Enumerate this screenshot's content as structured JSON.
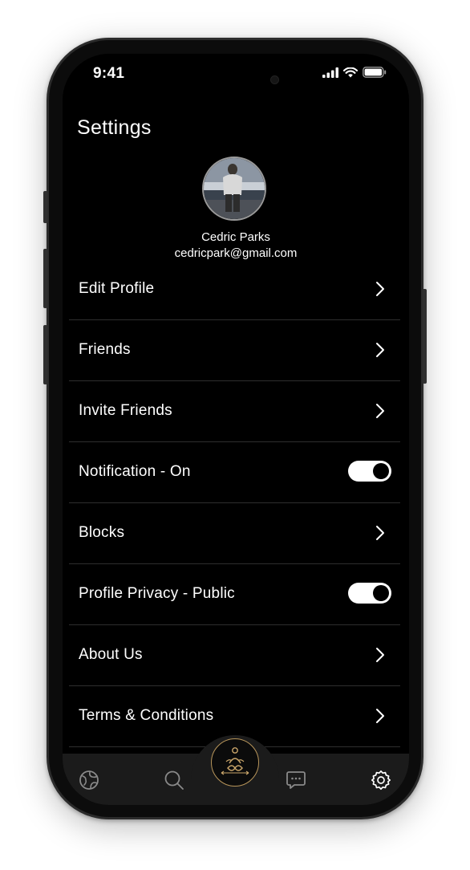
{
  "status_bar": {
    "time": "9:41",
    "icons": [
      "signal-icon",
      "wifi-icon",
      "battery-icon"
    ]
  },
  "header": {
    "title": "Settings"
  },
  "profile": {
    "name": "Cedric Parks",
    "email": "cedricpark@gmail.com",
    "avatar": "avatar-photo"
  },
  "menu": {
    "items": [
      {
        "label": "Edit Profile",
        "control": "chevron"
      },
      {
        "label": "Friends",
        "control": "chevron"
      },
      {
        "label": "Invite Friends",
        "control": "chevron"
      },
      {
        "label": "Notification - On",
        "control": "toggle",
        "toggle_on": true
      },
      {
        "label": "Blocks",
        "control": "chevron"
      },
      {
        "label": "Profile Privacy - Public",
        "control": "toggle",
        "toggle_on": true
      },
      {
        "label": "About Us",
        "control": "chevron"
      },
      {
        "label": "Terms & Conditions",
        "control": "chevron"
      }
    ]
  },
  "tab_bar": {
    "tabs": [
      {
        "icon": "globe-icon"
      },
      {
        "icon": "search-icon"
      },
      {
        "icon": "meditation-logo-icon",
        "active": true
      },
      {
        "icon": "chat-icon"
      },
      {
        "icon": "gear-icon"
      }
    ]
  },
  "colors": {
    "background": "#000000",
    "text": "#ffffff",
    "divider": "#2e2e2e",
    "tab_bar": "#1b1b1b",
    "accent_gold": "#b8955a"
  }
}
